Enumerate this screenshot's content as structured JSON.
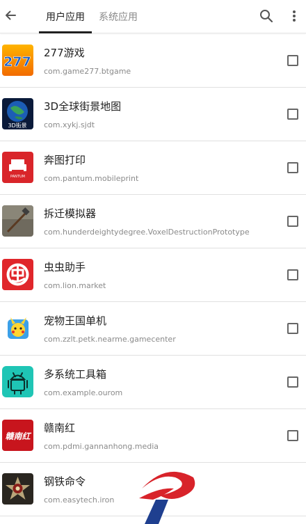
{
  "tabs": {
    "user": "用户应用",
    "system": "系统应用"
  },
  "icons": {
    "back": "arrow-back-icon",
    "search": "search-icon",
    "more": "more-vert-icon"
  },
  "apps": [
    {
      "name": "277游戏",
      "package": "com.game277.btgame",
      "icon_text": "277",
      "checked": false
    },
    {
      "name": "3D全球街景地图",
      "package": "com.xykj.sjdt",
      "icon_text": "3D街景",
      "checked": false
    },
    {
      "name": "奔图打印",
      "package": "com.pantum.mobileprint",
      "icon_text": "PANTUM",
      "checked": false
    },
    {
      "name": "拆迁模拟器",
      "package": "com.hunderdeightydegree.VoxelDestructionPrototype",
      "checked": false
    },
    {
      "name": "虫虫助手",
      "package": "com.lion.market",
      "checked": false
    },
    {
      "name": "宠物王国单机",
      "package": "com.zzlt.petk.nearme.gamecenter",
      "checked": false
    },
    {
      "name": "多系统工具箱",
      "package": "com.example.ourom",
      "checked": false
    },
    {
      "name": "赣南红",
      "package": "com.pdmi.gannanhong.media",
      "icon_text": "赣南红",
      "checked": false
    },
    {
      "name": "钢铁命令",
      "package": "com.easytech.iron",
      "checked": false
    }
  ],
  "colors": {
    "text_primary": "#212121",
    "text_secondary": "#8a8a8a",
    "divider": "#e0e0e0",
    "watermark_red": "#d8232a",
    "watermark_blue": "#1f3f8f"
  }
}
